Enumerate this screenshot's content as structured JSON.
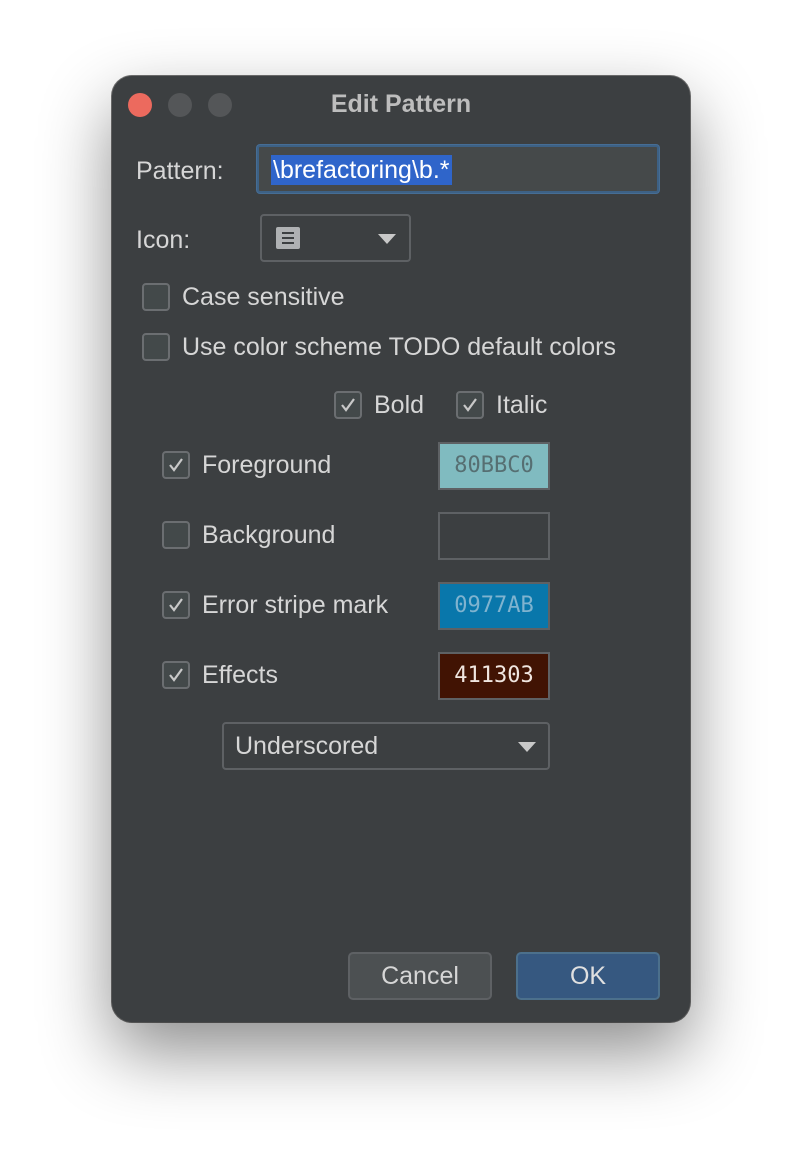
{
  "window": {
    "title": "Edit Pattern"
  },
  "pattern": {
    "label": "Pattern:",
    "value": "\\brefactoring\\b.*"
  },
  "icon": {
    "label": "Icon:",
    "selected_icon": "list-icon"
  },
  "options": {
    "case_sensitive": {
      "label": "Case sensitive",
      "checked": false
    },
    "use_default_colors": {
      "label": "Use color scheme TODO default colors",
      "checked": false
    }
  },
  "font_style": {
    "bold": {
      "label": "Bold",
      "checked": true
    },
    "italic": {
      "label": "Italic",
      "checked": true
    }
  },
  "colors": {
    "foreground": {
      "label": "Foreground",
      "checked": true,
      "value": "80BBC0",
      "swatch": "#80BBC0",
      "text_color": "#566f72"
    },
    "background": {
      "label": "Background",
      "checked": false,
      "value": "",
      "swatch": "#3c3f41"
    },
    "error_stripe": {
      "label": "Error stripe mark",
      "checked": true,
      "value": "0977AB",
      "swatch": "#0977AB",
      "text_color": "#7fb3cf"
    },
    "effects": {
      "label": "Effects",
      "checked": true,
      "value": "411303",
      "swatch": "#411303",
      "text_color": "#f0e6e0"
    }
  },
  "effect_type": {
    "selected": "Underscored"
  },
  "buttons": {
    "cancel": "Cancel",
    "ok": "OK"
  },
  "theme": {
    "accent": "#365880",
    "selection": "#2f65ca",
    "panel": "#3c3f41"
  }
}
